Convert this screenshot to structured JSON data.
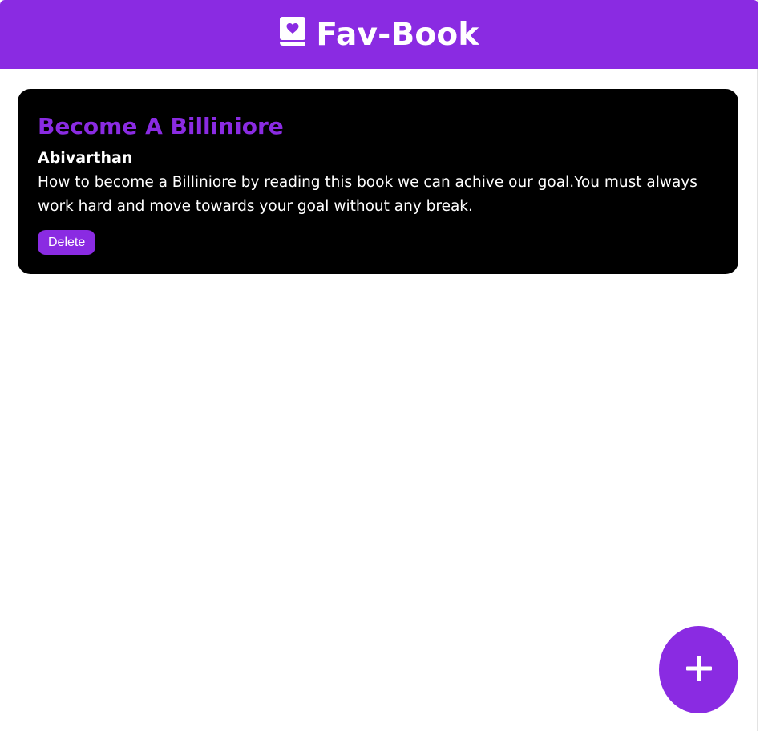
{
  "header": {
    "title": "Fav-Book",
    "icon": "book-heart-icon",
    "background": "#8a2be2"
  },
  "books": [
    {
      "title": "Become A Billiniore",
      "author": "Abivarthan",
      "description": "How to become a Billiniore by reading this book we can achive our goal.You must always work hard and move towards your goal without any break.",
      "delete_label": "Delete"
    }
  ],
  "fab": {
    "icon": "plus-icon",
    "color": "#8a2be2"
  },
  "colors": {
    "accent": "#8a2be2",
    "card_background": "#000000",
    "text_on_dark": "#ffffff"
  }
}
